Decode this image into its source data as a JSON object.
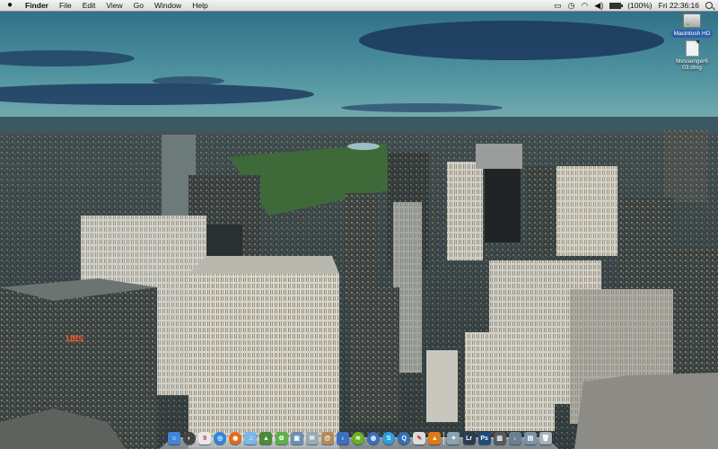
{
  "menubar": {
    "apple_icon": "apple-icon",
    "app_name": "Finder",
    "menus": [
      "File",
      "Edit",
      "View",
      "Go",
      "Window",
      "Help"
    ],
    "battery_text": "(100%)",
    "clock": "Fri 22:36:16",
    "status_icons": [
      "display-icon",
      "time-machine-icon",
      "wifi-icon",
      "volume-icon",
      "battery-icon",
      "spotlight-icon"
    ],
    "battery_level": 1.0
  },
  "desktop": {
    "icons": [
      {
        "label": "Macintosh HD",
        "icon": "hard-drive-icon"
      },
      {
        "label": "Messenger6 03.dmg",
        "icon": "disk-image-icon"
      }
    ]
  },
  "wallpaper": {
    "description_colors": {
      "sky": "#2e6a80",
      "cloud": "#1c3a5e",
      "city": "#2a3a3f",
      "park": "#3f6b3a",
      "sign": "#ff5a1f"
    },
    "sign_text": "UBS"
  },
  "dock": {
    "items": [
      {
        "name": "finder",
        "color": "#3d86d8",
        "glyph": "☺"
      },
      {
        "name": "dashboard",
        "color": "#444444",
        "glyph": "◐"
      },
      {
        "name": "ical",
        "color": "#e8e8e8",
        "glyph": "9"
      },
      {
        "name": "safari",
        "color": "#2f86e0",
        "glyph": "◎"
      },
      {
        "name": "firefox",
        "color": "#e56a1a",
        "glyph": "◉"
      },
      {
        "name": "itunes",
        "color": "#7bb7e8",
        "glyph": "♫"
      },
      {
        "name": "iphoto",
        "color": "#4c8a3a",
        "glyph": "▲"
      },
      {
        "name": "messenger",
        "color": "#5db04a",
        "glyph": "✿"
      },
      {
        "name": "preview",
        "color": "#6a8fb5",
        "glyph": "▣"
      },
      {
        "name": "mail",
        "color": "#9aa9b6",
        "glyph": "✉"
      },
      {
        "name": "address-book",
        "color": "#b38a5a",
        "glyph": "@"
      },
      {
        "name": "itunes-2",
        "color": "#3b6fc0",
        "glyph": "♪"
      },
      {
        "name": "spotify",
        "color": "#6ab21e",
        "glyph": "≋"
      },
      {
        "name": "system",
        "color": "#3a6dc2",
        "glyph": "◍"
      },
      {
        "name": "skype",
        "color": "#2aa0e0",
        "glyph": "S"
      },
      {
        "name": "quicktime",
        "color": "#3470b8",
        "glyph": "Q"
      },
      {
        "name": "text",
        "color": "#dcdcdc",
        "glyph": "✎"
      },
      {
        "name": "vlc",
        "color": "#e07b14",
        "glyph": "▲"
      },
      {
        "name": "app-store",
        "color": "#8aa2b3",
        "glyph": "✦"
      },
      {
        "name": "lightroom",
        "color": "#2b3d4d",
        "glyph": "Lr"
      },
      {
        "name": "photoshop",
        "color": "#1d4b7a",
        "glyph": "Ps"
      },
      {
        "name": "activity-monitor",
        "color": "#5a5a5a",
        "glyph": "▥"
      },
      {
        "name": "downloads",
        "color": "#6b7f94",
        "glyph": "↓"
      },
      {
        "name": "documents",
        "color": "#7c93aa",
        "glyph": "▤"
      },
      {
        "name": "trash",
        "color": "#a9b2ba",
        "glyph": "🗑"
      }
    ],
    "separator_after_index": 17
  }
}
